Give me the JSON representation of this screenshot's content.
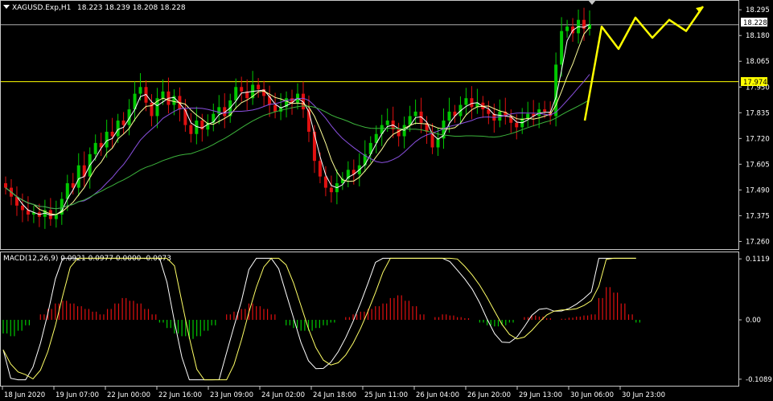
{
  "window": {
    "symbol_header": "XAGUSD.Exp,H1",
    "ohlc": "18.223 18.239 18.208 18.228",
    "menu_icon": "triangle-down-icon"
  },
  "colors": {
    "background": "#000000",
    "bull": "#00c800",
    "bear": "#e01010",
    "ma_fast": "#ffffff",
    "ma_mid": "#ffff99",
    "ma_slow_purple": "#8a50e0",
    "ma_slow_green": "#3cb43c",
    "forecast": "#ffff00",
    "level_line": "#ffff00",
    "grid_line": "#c8c8c8"
  },
  "price_axis": {
    "ticks": [
      "18.295",
      "18.180",
      "18.065",
      "17.950",
      "17.835",
      "17.720",
      "17.605",
      "17.490",
      "17.375",
      "17.260"
    ],
    "current_price_label": "18.228",
    "level_label": "17.974"
  },
  "macd": {
    "label": "MACD(12,26,9) 0.0921 0.0977 0.0000 -0.0073",
    "ticks": [
      "0.1119",
      "0.00",
      "-0.1089"
    ]
  },
  "time_axis": {
    "labels": [
      "18 Jun 2020",
      "19 Jun 07:00",
      "22 Jun 00:00",
      "22 Jun 16:00",
      "23 Jun 09:00",
      "24 Jun 02:00",
      "24 Jun 18:00",
      "25 Jun 11:00",
      "26 Jun 04:00",
      "26 Jun 20:00",
      "29 Jun 13:00",
      "30 Jun 06:00",
      "30 Jun 23:00"
    ]
  },
  "chart_data": {
    "type": "candlestick",
    "symbol": "XAGUSD.Exp",
    "timeframe": "H1",
    "ylim": [
      17.24,
      18.31
    ],
    "horizontal_levels": [
      18.228,
      17.974
    ],
    "candles_close": [
      17.5,
      17.46,
      17.42,
      17.4,
      17.38,
      17.39,
      17.37,
      17.4,
      17.36,
      17.38,
      17.45,
      17.52,
      17.5,
      17.6,
      17.55,
      17.65,
      17.7,
      17.68,
      17.75,
      17.73,
      17.8,
      17.78,
      17.85,
      17.92,
      17.95,
      17.88,
      17.82,
      17.9,
      17.93,
      17.87,
      17.91,
      17.85,
      17.78,
      17.74,
      17.8,
      17.76,
      17.79,
      17.83,
      17.86,
      17.82,
      17.89,
      17.95,
      17.93,
      17.9,
      17.96,
      17.94,
      17.91,
      17.87,
      17.84,
      17.86,
      17.9,
      17.88,
      17.92,
      17.85,
      17.75,
      17.62,
      17.55,
      17.5,
      17.48,
      17.52,
      17.54,
      17.58,
      17.56,
      17.6,
      17.65,
      17.7,
      17.74,
      17.78,
      17.8,
      17.76,
      17.73,
      17.78,
      17.82,
      17.84,
      17.79,
      17.75,
      17.68,
      17.72,
      17.8,
      17.84,
      17.82,
      17.87,
      17.9,
      17.86,
      17.88,
      17.85,
      17.83,
      17.8,
      17.84,
      17.82,
      17.79,
      17.77,
      17.81,
      17.83,
      17.82,
      17.85,
      17.84,
      17.82,
      18.05,
      18.2,
      18.22,
      18.19,
      18.25,
      18.21,
      18.23
    ],
    "forecast_path": [
      [
        0,
        17.8
      ],
      [
        1,
        18.22
      ],
      [
        2,
        18.12
      ],
      [
        3,
        18.26
      ],
      [
        4,
        18.17
      ],
      [
        5,
        18.25
      ],
      [
        6,
        18.2
      ],
      [
        7,
        18.31
      ]
    ],
    "moving_averages": [
      "fast",
      "mid",
      "slow_purple",
      "slow_green"
    ]
  },
  "macd_data": {
    "ylim": [
      -0.115,
      0.118
    ],
    "histogram": [
      -0.025,
      -0.03,
      -0.02,
      -0.01,
      0.0,
      0.01,
      0.02,
      0.03,
      0.035,
      0.03,
      0.025,
      0.02,
      0.015,
      0.01,
      0.02,
      0.03,
      0.04,
      0.035,
      0.03,
      0.02,
      0.01,
      -0.005,
      -0.015,
      -0.025,
      -0.03,
      -0.035,
      -0.03,
      -0.02,
      -0.01,
      0.0,
      0.01,
      0.015,
      0.02,
      0.03,
      0.025,
      0.02,
      0.01,
      0.0,
      -0.01,
      -0.015,
      -0.02,
      -0.02,
      -0.015,
      -0.01,
      -0.005,
      0.0,
      0.005,
      0.01,
      0.015,
      0.02,
      0.025,
      0.03,
      0.04,
      0.045,
      0.035,
      0.025,
      0.01,
      0.0,
      0.005,
      0.01,
      0.008,
      0.005,
      0.003,
      0.0,
      -0.005,
      -0.01,
      -0.012,
      -0.01,
      -0.005,
      0.0,
      0.005,
      0.008,
      0.006,
      0.003,
      0.0,
      0.002,
      0.004,
      0.006,
      0.008,
      0.01,
      0.04,
      0.06,
      0.05,
      0.03,
      0.01,
      -0.005
    ]
  }
}
